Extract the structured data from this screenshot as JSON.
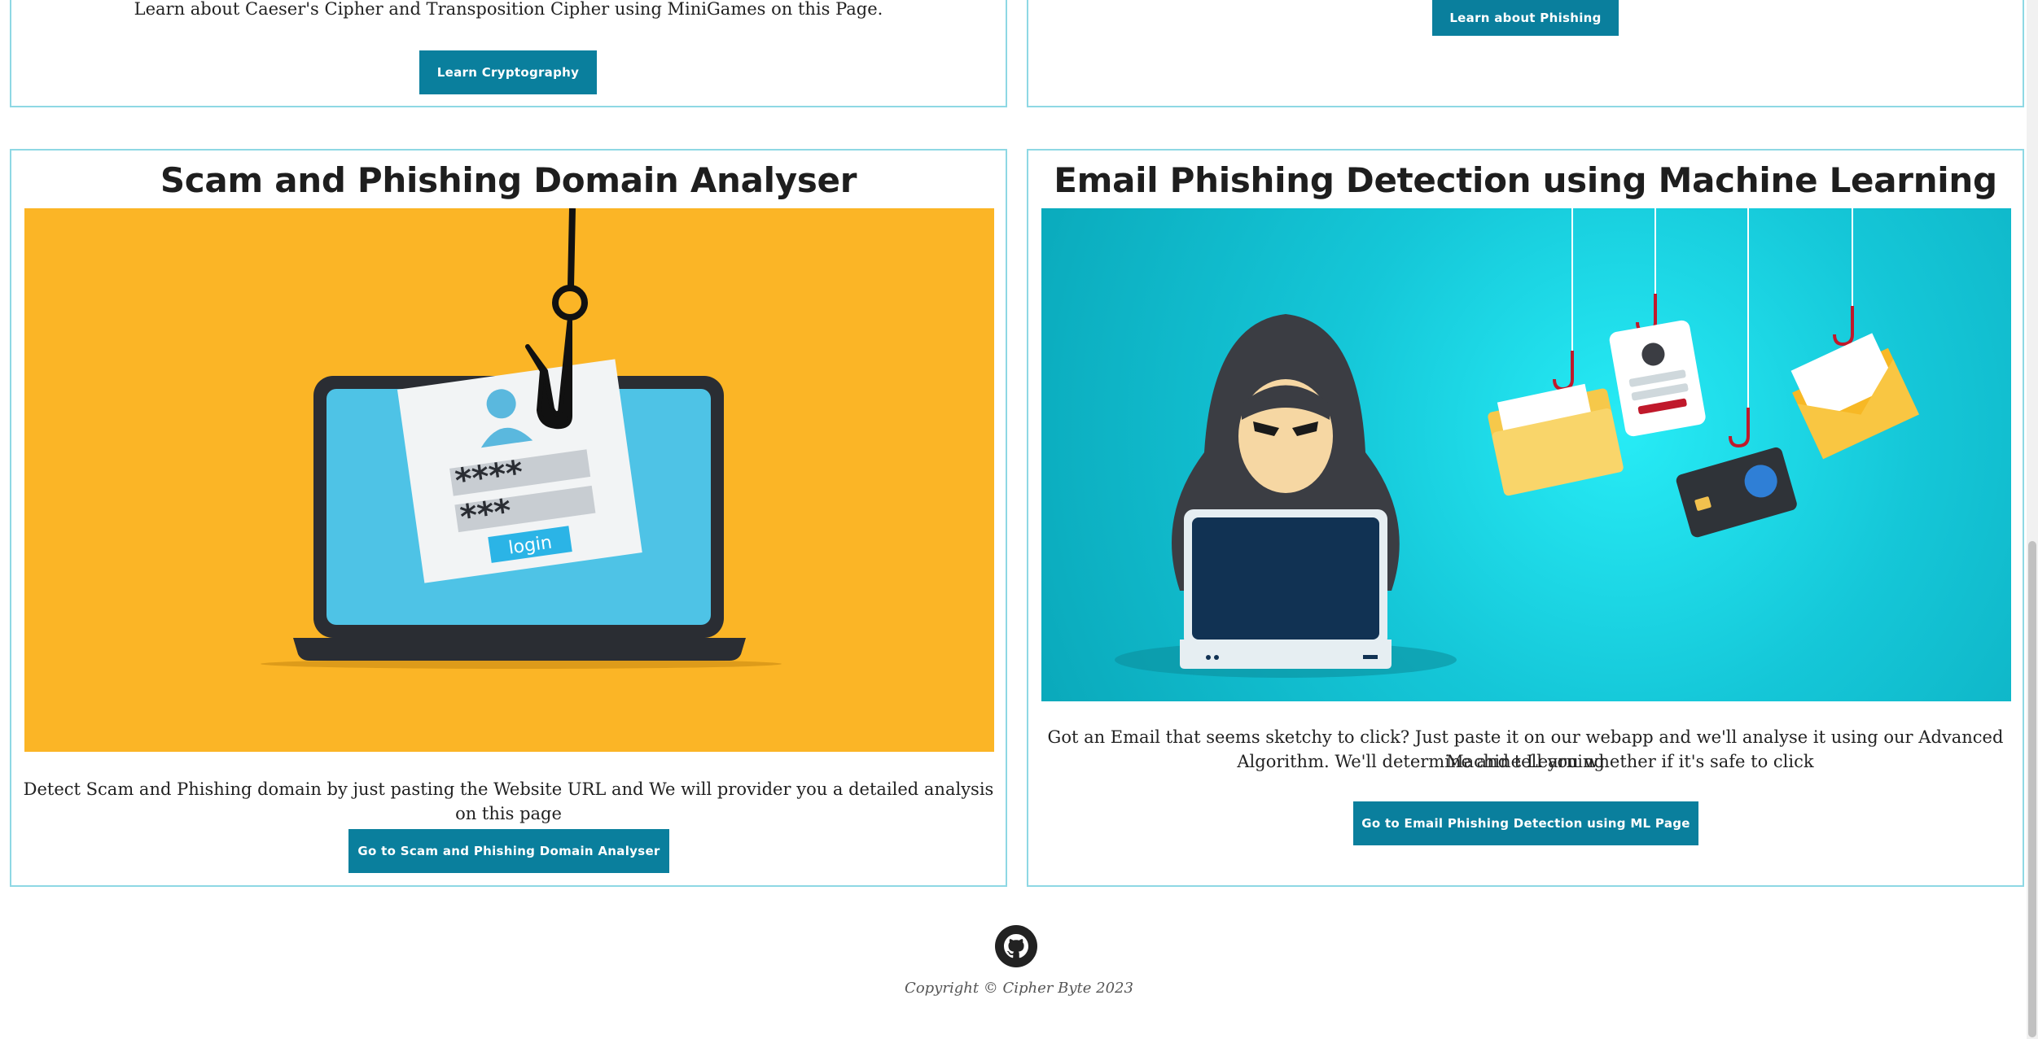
{
  "cards": {
    "cryptography": {
      "description": "Learn about Caeser's Cipher and Transposition Cipher using MiniGames on this Page.",
      "button": "Learn Cryptography"
    },
    "phishing": {
      "button": "Learn about Phishing"
    },
    "domain_analyser": {
      "title": "Scam and Phishing Domain Analyser",
      "image_text": {
        "pwd1": "****",
        "pwd2": "***",
        "login": "login"
      },
      "description": "Detect Scam and Phishing domain by just pasting the Website URL and We will provider you a detailed analysis on this page",
      "button": "Go to Scam and Phishing Domain Analyser"
    },
    "email_detection": {
      "title": "Email Phishing Detection using Machine Learning",
      "description_line1": "Got an Email that seems sketchy to click? Just paste it on our webapp and we'll analyse it using our Advanced Machine Learning",
      "description_line2": "Algorithm. We'll determine and tell you whether if it's safe to click",
      "button": "Go to Email Phishing Detection using ML Page"
    }
  },
  "footer": {
    "icon": "github-icon",
    "copyright": "Copyright © Cipher Byte 2023"
  },
  "colors": {
    "accent": "#0a7f9d",
    "card_border": "#8ed8e4",
    "yellow_bg": "#fbb526",
    "cyan_bg": "#15c7d8"
  }
}
